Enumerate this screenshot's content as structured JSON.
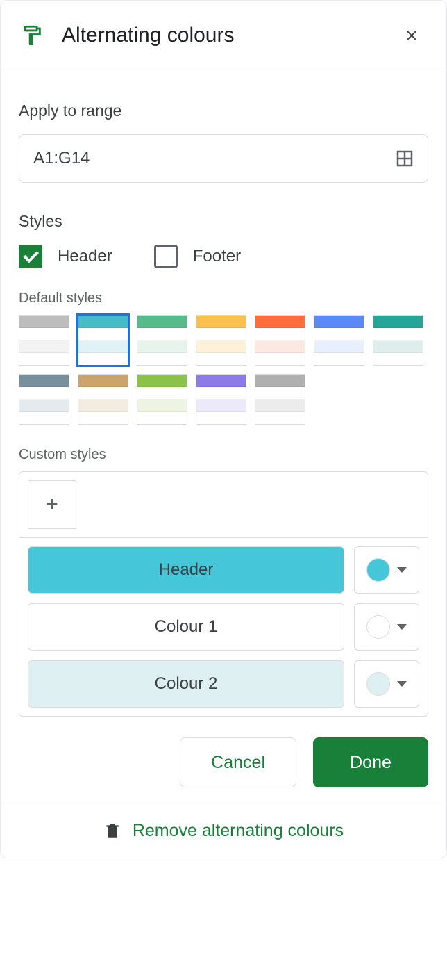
{
  "title": "Alternating colours",
  "apply_label": "Apply to range",
  "range_value": "A1:G14",
  "styles_label": "Styles",
  "header_check": {
    "label": "Header",
    "checked": true
  },
  "footer_check": {
    "label": "Footer",
    "checked": false
  },
  "default_label": "Default styles",
  "default_styles": [
    {
      "header": "#bdbdbd",
      "c1": "#ffffff",
      "c2": "#f3f3f3",
      "selected": false
    },
    {
      "header": "#46bdc6",
      "c1": "#ffffff",
      "c2": "#e0f2f5",
      "selected": true
    },
    {
      "header": "#57bb8a",
      "c1": "#ffffff",
      "c2": "#e7f4ec",
      "selected": false
    },
    {
      "header": "#fbc04d",
      "c1": "#ffffff",
      "c2": "#fdf2d8",
      "selected": false
    },
    {
      "header": "#ff6d3a",
      "c1": "#ffffff",
      "c2": "#fce8e0",
      "selected": false
    },
    {
      "header": "#5b8af8",
      "c1": "#ffffff",
      "c2": "#e8effd",
      "selected": false
    },
    {
      "header": "#26a69a",
      "c1": "#ffffff",
      "c2": "#ddeeec",
      "selected": false
    },
    {
      "header": "#78909c",
      "c1": "#ffffff",
      "c2": "#e4eaee",
      "selected": false
    },
    {
      "header": "#cca26d",
      "c1": "#ffffff",
      "c2": "#f3ece1",
      "selected": false
    },
    {
      "header": "#8bc34a",
      "c1": "#ffffff",
      "c2": "#edf4e1",
      "selected": false
    },
    {
      "header": "#8c7ae6",
      "c1": "#ffffff",
      "c2": "#ece9fa",
      "selected": false
    },
    {
      "header": "#b0b0b0",
      "c1": "#ffffff",
      "c2": "#ececec",
      "selected": false
    }
  ],
  "custom_label": "Custom styles",
  "custom_rows": [
    {
      "label": "Header",
      "bg": "#46c6d9",
      "swatch": "#46c6d9"
    },
    {
      "label": "Colour 1",
      "bg": "#ffffff",
      "swatch": "#ffffff"
    },
    {
      "label": "Colour 2",
      "bg": "#def0f2",
      "swatch": "#def0f2"
    }
  ],
  "buttons": {
    "cancel": "Cancel",
    "done": "Done"
  },
  "remove_label": "Remove alternating colours"
}
